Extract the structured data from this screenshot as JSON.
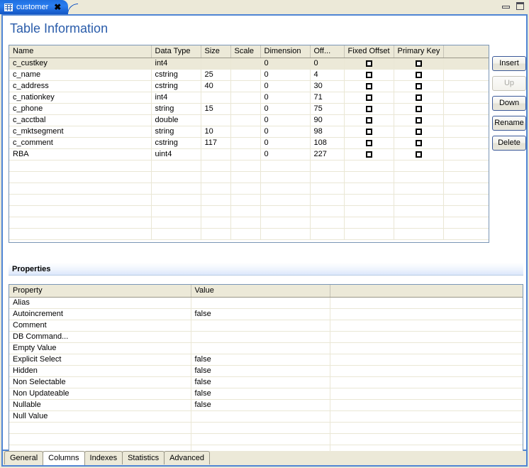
{
  "window": {
    "tab": {
      "title": "customer",
      "icon": "table-icon",
      "close_label": "✖"
    },
    "controls": {
      "minimize": "minimize-icon",
      "maximize": "maximize-icon"
    }
  },
  "page": {
    "title": "Table Information"
  },
  "columns_table": {
    "headers": [
      "Name",
      "Data Type",
      "Size",
      "Scale",
      "Dimension",
      "Off...",
      "Fixed Offset",
      "Primary Key",
      ""
    ],
    "rows": [
      {
        "name": "c_custkey",
        "data_type": "int4",
        "size": "",
        "scale": "",
        "dimension": "0",
        "offset": "0",
        "fixed_offset": false,
        "primary_key": false,
        "selected": true
      },
      {
        "name": "c_name",
        "data_type": "cstring",
        "size": "25",
        "scale": "",
        "dimension": "0",
        "offset": "4",
        "fixed_offset": false,
        "primary_key": false,
        "selected": false
      },
      {
        "name": "c_address",
        "data_type": "cstring",
        "size": "40",
        "scale": "",
        "dimension": "0",
        "offset": "30",
        "fixed_offset": false,
        "primary_key": false,
        "selected": false
      },
      {
        "name": "c_nationkey",
        "data_type": "int4",
        "size": "",
        "scale": "",
        "dimension": "0",
        "offset": "71",
        "fixed_offset": false,
        "primary_key": false,
        "selected": false
      },
      {
        "name": "c_phone",
        "data_type": "string",
        "size": "15",
        "scale": "",
        "dimension": "0",
        "offset": "75",
        "fixed_offset": false,
        "primary_key": false,
        "selected": false
      },
      {
        "name": "c_acctbal",
        "data_type": "double",
        "size": "",
        "scale": "",
        "dimension": "0",
        "offset": "90",
        "fixed_offset": false,
        "primary_key": false,
        "selected": false
      },
      {
        "name": "c_mktsegment",
        "data_type": "string",
        "size": "10",
        "scale": "",
        "dimension": "0",
        "offset": "98",
        "fixed_offset": false,
        "primary_key": false,
        "selected": false
      },
      {
        "name": "c_comment",
        "data_type": "cstring",
        "size": "117",
        "scale": "",
        "dimension": "0",
        "offset": "108",
        "fixed_offset": false,
        "primary_key": false,
        "selected": false
      },
      {
        "name": "RBA",
        "data_type": "uint4",
        "size": "",
        "scale": "",
        "dimension": "0",
        "offset": "227",
        "fixed_offset": false,
        "primary_key": false,
        "selected": false
      }
    ],
    "empty_row_count": 7
  },
  "side_buttons": [
    {
      "label": "Insert",
      "enabled": true
    },
    {
      "label": "Up",
      "enabled": false
    },
    {
      "label": "Down",
      "enabled": true
    },
    {
      "label": "Rename",
      "enabled": true
    },
    {
      "label": "Delete",
      "enabled": true
    }
  ],
  "properties": {
    "section_title": "Properties",
    "headers": [
      "Property",
      "Value",
      ""
    ],
    "rows": [
      {
        "property": "Alias",
        "value": ""
      },
      {
        "property": "Autoincrement",
        "value": "false"
      },
      {
        "property": "Comment",
        "value": ""
      },
      {
        "property": "DB Command...",
        "value": ""
      },
      {
        "property": "Empty Value",
        "value": ""
      },
      {
        "property": "Explicit Select",
        "value": "false"
      },
      {
        "property": "Hidden",
        "value": "false"
      },
      {
        "property": "Non Selectable",
        "value": "false"
      },
      {
        "property": "Non Updateable",
        "value": "false"
      },
      {
        "property": "Nullable",
        "value": "false"
      },
      {
        "property": "Null Value",
        "value": ""
      }
    ],
    "empty_row_count": 3
  },
  "bottom_tabs": [
    {
      "label": "General",
      "active": false
    },
    {
      "label": "Columns",
      "active": true
    },
    {
      "label": "Indexes",
      "active": false
    },
    {
      "label": "Statistics",
      "active": false
    },
    {
      "label": "Advanced",
      "active": false
    }
  ],
  "colors": {
    "accent_blue": "#4f85d4",
    "title_blue": "#2a5caa",
    "header_beige": "#ece9d8",
    "selection_beige": "#ece9d8"
  }
}
